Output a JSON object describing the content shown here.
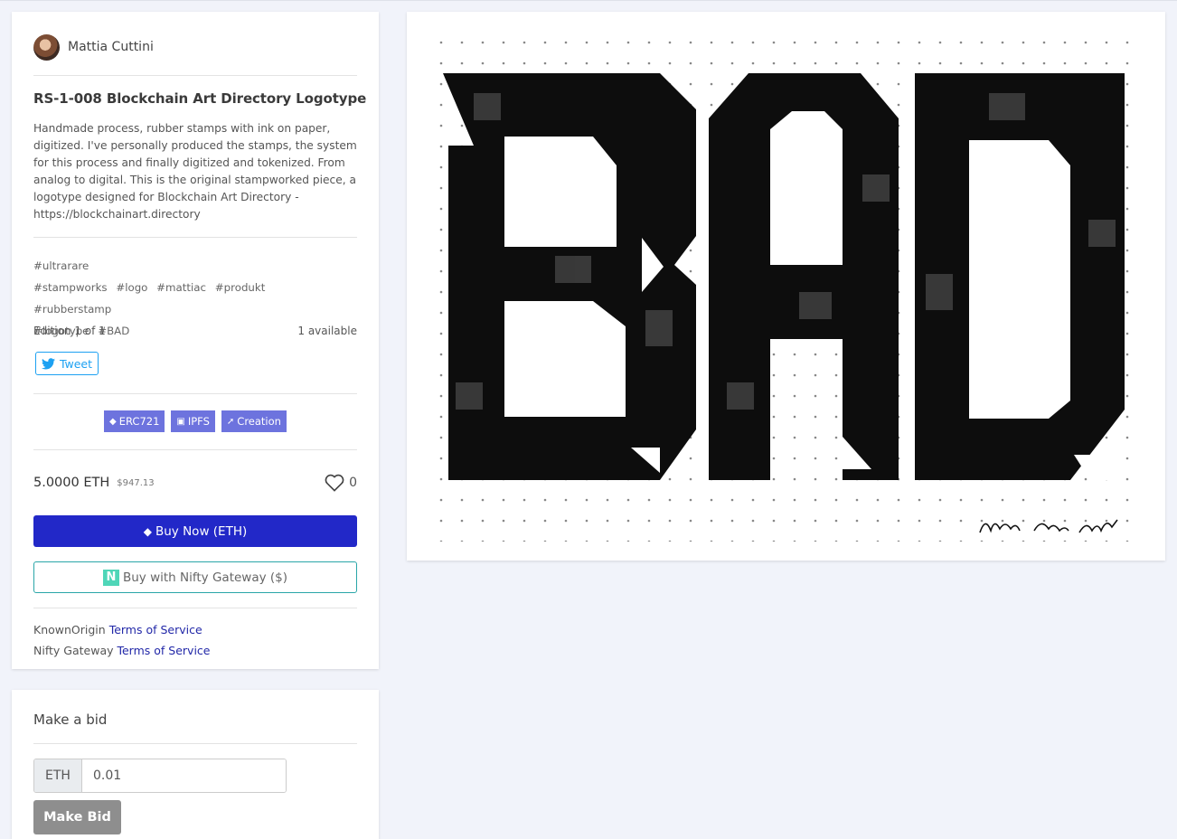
{
  "artist": {
    "name": "Mattia Cuttini"
  },
  "artwork": {
    "title": "RS-1-008 Blockchain Art Directory Logotype",
    "description": "Handmade process, rubber stamps with ink on paper, digitized. I've personally produced the stamps, the system for this process and finally digitized and tokenized. From analog to digital. This is the original stampworked piece, a logotype designed for Blockchain Art Directory - https://blockchainart.directory",
    "tags": [
      "#ultrarare",
      "#stampworks",
      "#logo",
      "#mattiac",
      "#produkt",
      "#rubberstamp",
      "#logotype",
      "#BAD"
    ],
    "image_text": "BAD",
    "signature": "Mattia Cuttini 2K19"
  },
  "edition": {
    "label": "Edition 1 of 1",
    "available": "1 available"
  },
  "tweet_label": "Tweet",
  "badges": [
    {
      "icon": "ethereum-icon",
      "label": "ERC721"
    },
    {
      "icon": "cube-icon",
      "label": "IPFS"
    },
    {
      "icon": "bolt-icon",
      "label": "Creation"
    }
  ],
  "price": {
    "eth": "5.0000 ETH",
    "usd": "$947.13",
    "likes": "0"
  },
  "buttons": {
    "buy_now": "Buy Now (ETH)",
    "buy_nifty": "Buy with Nifty Gateway ($)",
    "nifty_logo": "N"
  },
  "terms": [
    {
      "provider": "KnownOrigin",
      "link": "Terms of Service"
    },
    {
      "provider": "Nifty Gateway",
      "link": "Terms of Service"
    }
  ],
  "bid": {
    "title": "Make a bid",
    "currency": "ETH",
    "value": "0.01",
    "button": "Make Bid"
  },
  "colors": {
    "page_bg": "#f1f3fa",
    "primary": "#2228c8",
    "badge": "#6d73de",
    "twitter": "#1da1f2",
    "nifty": "#2aa6a8",
    "link": "#2228a8"
  }
}
